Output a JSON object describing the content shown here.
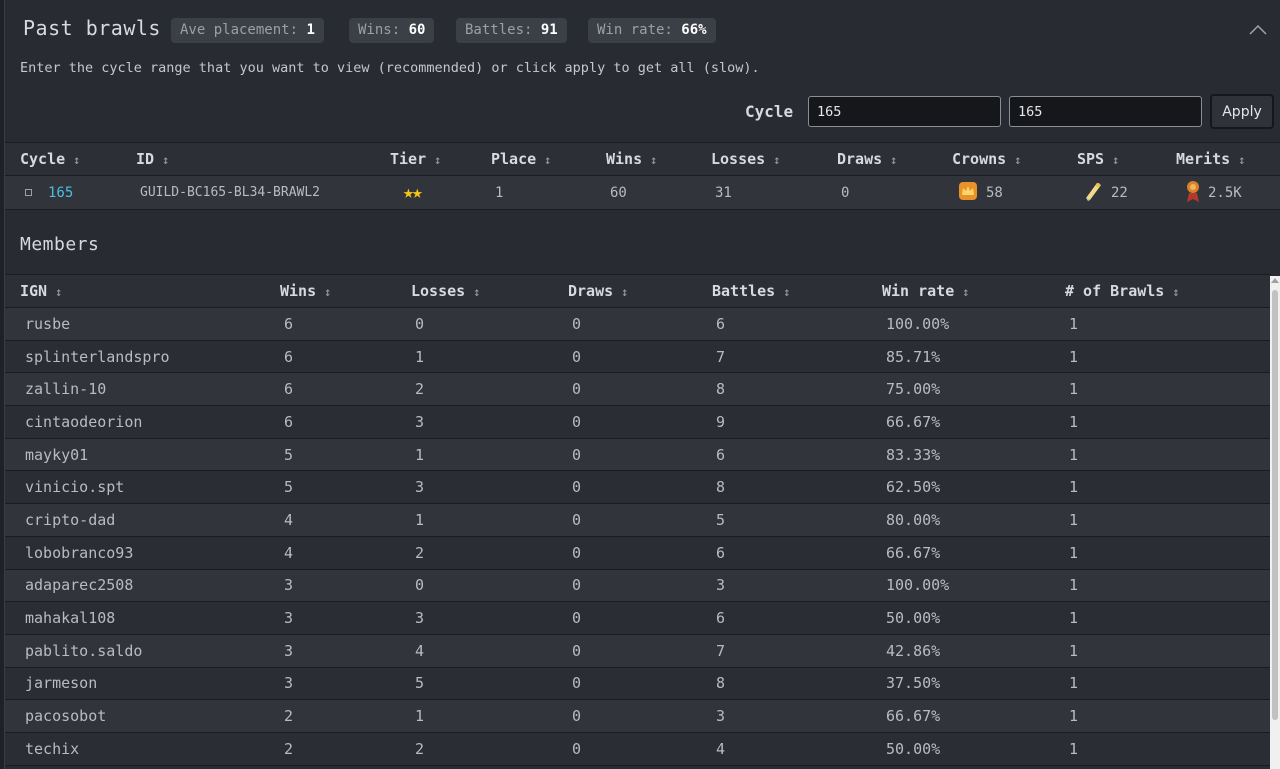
{
  "header": {
    "title": "Past brawls",
    "badges": [
      {
        "label": "Ave placement:",
        "value": "1"
      },
      {
        "label": "Wins:",
        "value": "60"
      },
      {
        "label": "Battles:",
        "value": "91"
      },
      {
        "label": "Win rate:",
        "value": "66%"
      }
    ]
  },
  "description": "Enter the cycle range that you want to view (recommended) or click apply to get all (slow).",
  "filter": {
    "cycle_label": "Cycle",
    "from_value": "165",
    "to_value": "165",
    "apply_label": "Apply"
  },
  "brawl_table": {
    "columns": [
      "Cycle",
      "ID",
      "Tier",
      "Place",
      "Wins",
      "Losses",
      "Draws",
      "Crowns",
      "SPS",
      "Merits"
    ],
    "sort_glyph": "↕",
    "row": {
      "cycle": "165",
      "id": "GUILD-BC165-BL34-BRAWL2",
      "tier_stars": "★★",
      "place": "1",
      "wins": "60",
      "losses": "31",
      "draws": "0",
      "crowns": "58",
      "sps": "22",
      "merits": "2.5K"
    }
  },
  "members": {
    "title": "Members",
    "columns": [
      "IGN",
      "Wins",
      "Losses",
      "Draws",
      "Battles",
      "Win rate",
      "# of Brawls"
    ],
    "rows": [
      [
        "rusbe",
        "6",
        "0",
        "0",
        "6",
        "100.00%",
        "1"
      ],
      [
        "splinterlandspro",
        "6",
        "1",
        "0",
        "7",
        "85.71%",
        "1"
      ],
      [
        "zallin-10",
        "6",
        "2",
        "0",
        "8",
        "75.00%",
        "1"
      ],
      [
        "cintaodeorion",
        "6",
        "3",
        "0",
        "9",
        "66.67%",
        "1"
      ],
      [
        "mayky01",
        "5",
        "1",
        "0",
        "6",
        "83.33%",
        "1"
      ],
      [
        "vinicio.spt",
        "5",
        "3",
        "0",
        "8",
        "62.50%",
        "1"
      ],
      [
        "cripto-dad",
        "4",
        "1",
        "0",
        "5",
        "80.00%",
        "1"
      ],
      [
        "lobobranco93",
        "4",
        "2",
        "0",
        "6",
        "66.67%",
        "1"
      ],
      [
        "adaparec2508",
        "3",
        "0",
        "0",
        "3",
        "100.00%",
        "1"
      ],
      [
        "mahakal108",
        "3",
        "3",
        "0",
        "6",
        "50.00%",
        "1"
      ],
      [
        "pablito.saldo",
        "3",
        "4",
        "0",
        "7",
        "42.86%",
        "1"
      ],
      [
        "jarmeson",
        "3",
        "5",
        "0",
        "8",
        "37.50%",
        "1"
      ],
      [
        "pacosobot",
        "2",
        "1",
        "0",
        "3",
        "66.67%",
        "1"
      ],
      [
        "techix",
        "2",
        "2",
        "0",
        "4",
        "50.00%",
        "1"
      ]
    ]
  },
  "colors": {
    "accent_link": "#4bbfe0",
    "star": "#f5c518",
    "panel_bg": "#282b31"
  }
}
